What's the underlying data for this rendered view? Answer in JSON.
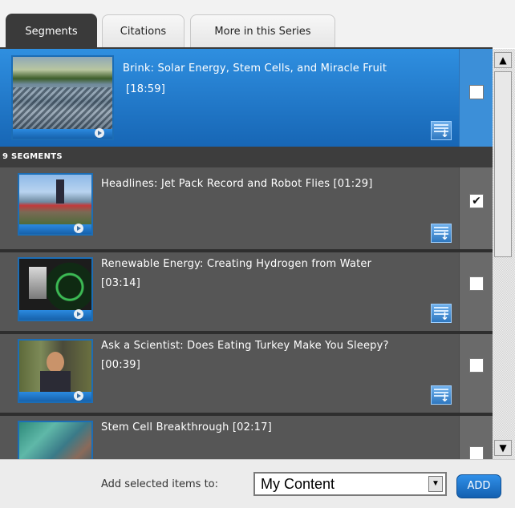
{
  "tabs": [
    {
      "label": "Segments",
      "active": true
    },
    {
      "label": "Citations",
      "active": false
    },
    {
      "label": "More in this Series",
      "active": false
    }
  ],
  "featured": {
    "title": "Brink: Solar Energy, Stem Cells, and Miracle Fruit",
    "duration": "[18:59]",
    "checked": false,
    "thumb": "solar-panels-thumbnail"
  },
  "segments_header": "9 SEGMENTS",
  "segments": [
    {
      "title": "Headlines: Jet Pack Record and Robot Flies",
      "duration": "[01:29]",
      "checked": true,
      "thumb": "jetpack-thumbnail"
    },
    {
      "title": "Renewable Energy: Creating Hydrogen from Water",
      "duration": "[03:14]",
      "checked": false,
      "thumb": "gauge-thumbnail"
    },
    {
      "title": "Ask a Scientist: Does Eating Turkey Make You Sleepy?",
      "duration": "[00:39]",
      "checked": false,
      "thumb": "scientist-thumbnail"
    },
    {
      "title": "Stem Cell Breakthrough",
      "duration": "[02:17]",
      "checked": false,
      "thumb": "surgery-thumbnail"
    }
  ],
  "footer": {
    "label": "Add selected items to:",
    "select_value": "My Content",
    "add_label": "ADD"
  },
  "colors": {
    "accent": "#1f78cc",
    "row_bg": "#565656",
    "header_bg": "#3d3d3d"
  }
}
